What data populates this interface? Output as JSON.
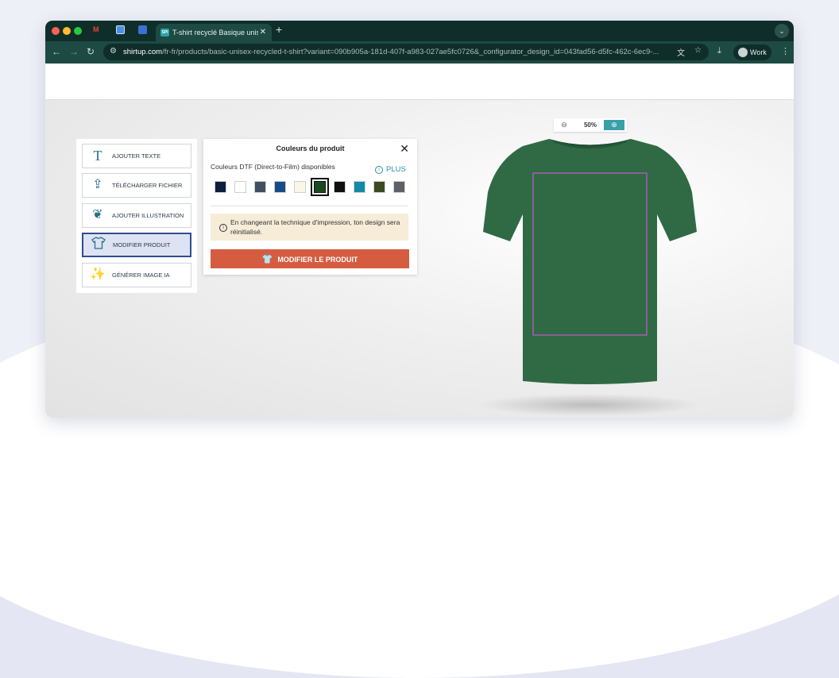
{
  "browser": {
    "tab_title": "T-shirt recyclé Basique unise",
    "tab_icon_text": "SPI",
    "url_host": "shirtup.com",
    "url_path": "/fr-fr/products/basic-unisex-recycled-t-shirt?variant=090b905a-181d-407f-a983-027ae5fc0726&_configurator_design_id=043fad56-d5fc-462c-6ec9-...",
    "profile_label": "Work"
  },
  "tools": [
    {
      "label": "AJOUTER TEXTE",
      "icon": "text-icon"
    },
    {
      "label": "TÉLÉCHARGER FICHIER",
      "icon": "upload-icon"
    },
    {
      "label": "AJOUTER ILLUSTRATION",
      "icon": "illustration-icon"
    },
    {
      "label": "MODIFIER PRODUIT",
      "icon": "tshirt-icon",
      "active": true
    },
    {
      "label": "GÉNÉRER IMAGE IA",
      "icon": "magic-wand-icon"
    }
  ],
  "panel": {
    "title": "Couleurs du produit",
    "subtitle": "Couleurs DTF (Direct-to-Film) disponibles",
    "more_label": "PLUS",
    "warning": "En changeant la technique d'impression, ton design sera réinitialisé.",
    "button_label": "MODIFIER LE PRODUIT"
  },
  "swatches": [
    "#0d1f3f",
    "#ffffff",
    "#3f5060",
    "#154e86",
    "#fbf7e6",
    "#1b4a20",
    "#101010",
    "#138aa6",
    "#3c4a22",
    "#5e6167"
  ],
  "selected_swatch": 5,
  "zoom": {
    "value": "50%"
  },
  "colors": {
    "shirt": "#2f6a44",
    "print_area": "#c45bd0",
    "accent": "#d65c41"
  }
}
